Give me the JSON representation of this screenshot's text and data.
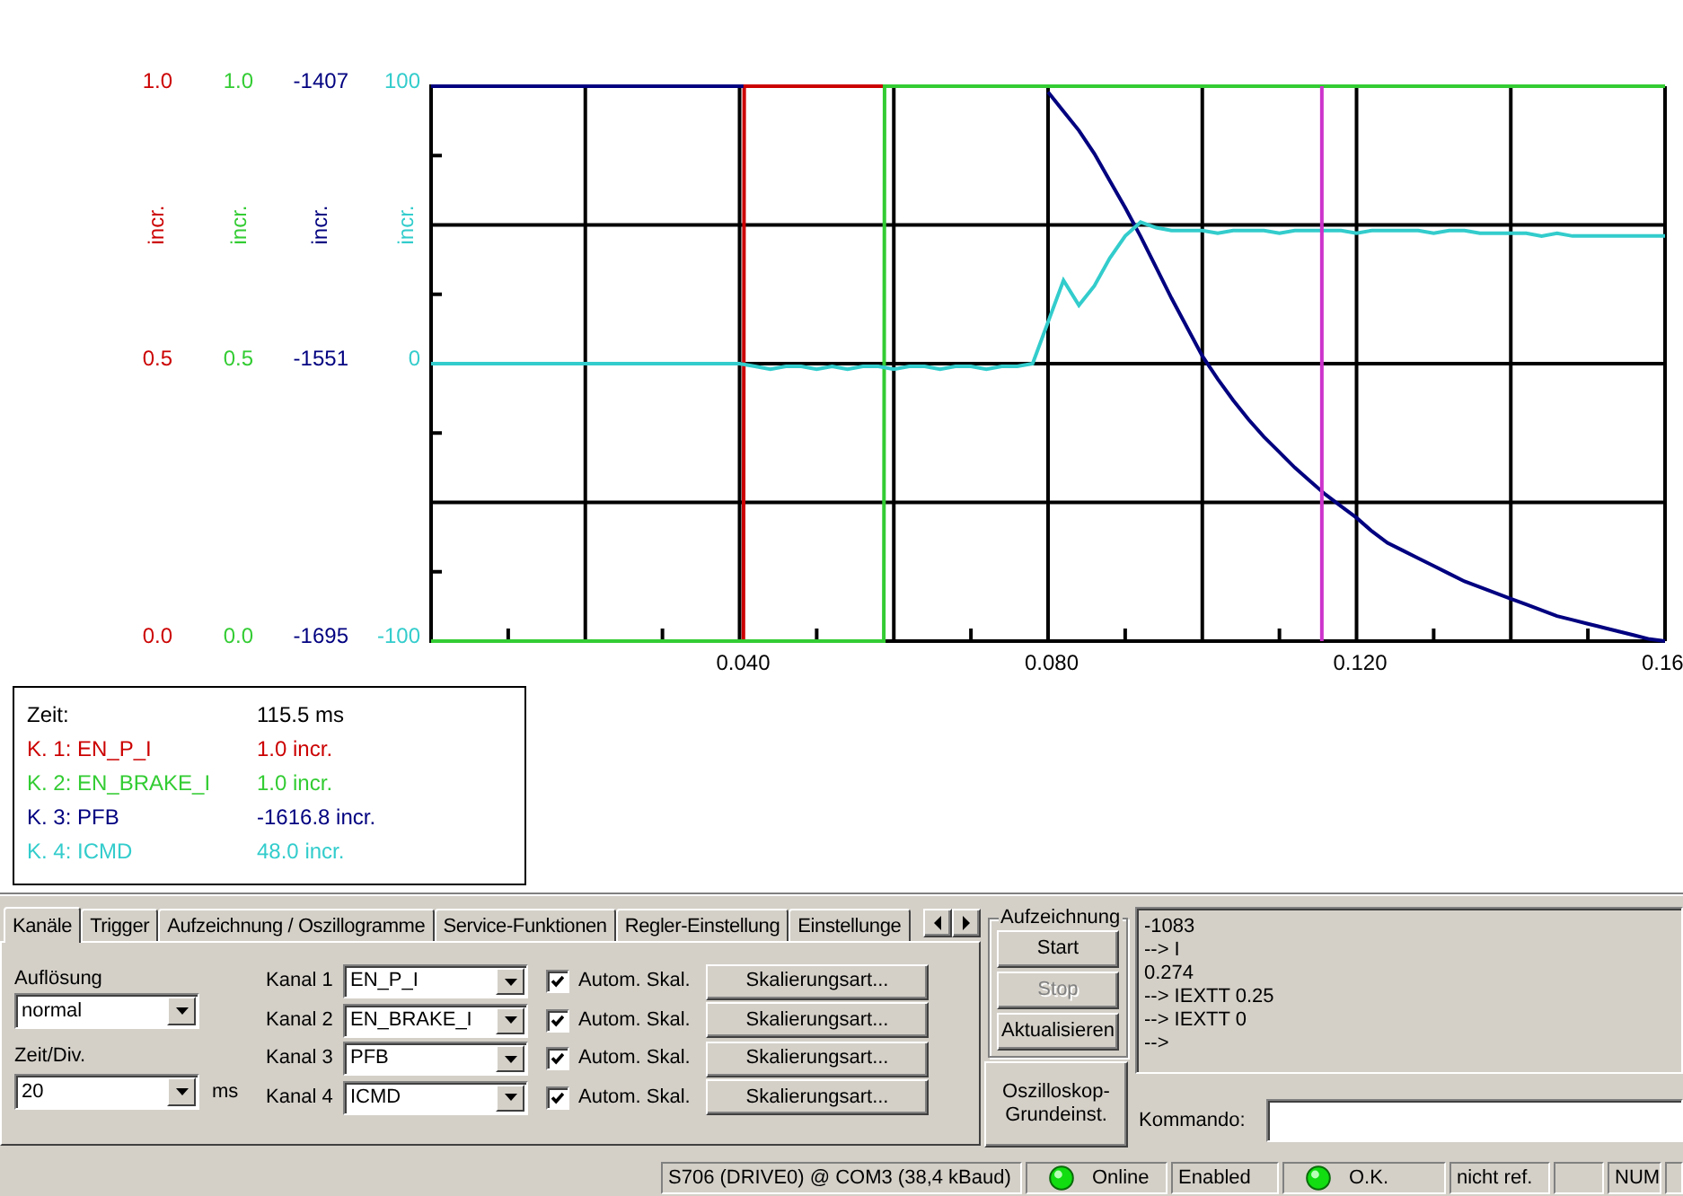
{
  "oscilloscope": {
    "channel_1_scale": {
      "labels": [
        "1.0",
        "0.5",
        "0.0"
      ],
      "unit": "incr."
    },
    "channel_plots": [
      {
        "chart_data": {
          "type": "line",
          "x": [
            0,
            0.0405,
            0.0406,
            0.0587,
            0.0588,
            0.16
          ],
          "xlim": [
            0,
            0.16
          ],
          "ylabel": "incr.",
          "ylim": [
            0,
            1
          ],
          "yticks": [
            {
              "value": 0,
              "label": "0.0"
            },
            {
              "value": 0.5,
              "label": "0.5"
            },
            {
              "value": 1,
              "label": "1.0"
            }
          ],
          "series": [
            {
              "color": "#cc0000",
              "values": [
                null,
                0,
                1,
                1,
                null,
                null
              ]
            },
            {
              "color": "#33cc33",
              "values": [
                0,
                0,
                0,
                0,
                1,
                1
              ]
            }
          ]
        }
      },
      {
        "chart_data": {
          "type": "line",
          "x": [
            0,
            0.0405,
            0.06,
            0.08,
            0.082,
            0.084,
            0.086,
            0.088,
            0.09,
            0.092,
            0.094,
            0.096,
            0.098,
            0.1,
            0.102,
            0.104,
            0.106,
            0.108,
            0.11,
            0.112,
            0.114,
            0.116,
            0.118,
            0.12,
            0.122,
            0.124,
            0.126,
            0.128,
            0.13,
            0.132,
            0.134,
            0.136,
            0.138,
            0.14,
            0.142,
            0.144,
            0.146,
            0.148,
            0.15,
            0.152,
            0.154,
            0.156,
            0.158,
            0.16
          ],
          "xlim": [
            0,
            0.16
          ],
          "ylabel": "incr.",
          "ylim": [
            -1695,
            -1407
          ],
          "yticks": [
            {
              "value": -1695,
              "label": "-1695"
            },
            {
              "value": -1551,
              "label": "-1551"
            },
            {
              "value": -1407,
              "label": "-1407"
            }
          ],
          "series": [
            {
              "color": "#000080",
              "values": [
                -1407,
                -1407,
                null,
                -1410,
                -1420,
                -1430,
                -1442,
                -1456,
                -1470,
                -1485,
                -1501,
                -1517,
                -1532,
                -1547,
                -1559,
                -1570,
                -1580,
                -1589,
                -1597,
                -1605,
                -1612,
                -1619,
                -1625,
                -1631,
                -1638,
                -1644,
                -1648,
                -1652,
                -1656,
                -1660,
                -1664,
                -1667,
                -1670,
                -1673,
                -1676,
                -1679,
                -1682,
                -1684,
                -1686,
                -1688,
                -1690,
                -1692,
                -1694,
                -1695
              ]
            }
          ]
        }
      },
      {
        "chart_data": {
          "type": "line",
          "x": [
            0,
            0.002,
            0.004,
            0.006,
            0.008,
            0.01,
            0.012,
            0.014,
            0.016,
            0.018,
            0.02,
            0.022,
            0.024,
            0.026,
            0.028,
            0.03,
            0.032,
            0.034,
            0.036,
            0.038,
            0.04,
            0.042,
            0.044,
            0.046,
            0.048,
            0.05,
            0.052,
            0.054,
            0.056,
            0.058,
            0.06,
            0.062,
            0.064,
            0.066,
            0.068,
            0.07,
            0.072,
            0.074,
            0.076,
            0.078,
            0.08,
            0.082,
            0.084,
            0.086,
            0.088,
            0.09,
            0.092,
            0.094,
            0.096,
            0.098,
            0.1,
            0.102,
            0.104,
            0.106,
            0.108,
            0.11,
            0.112,
            0.114,
            0.116,
            0.118,
            0.12,
            0.122,
            0.124,
            0.126,
            0.128,
            0.13,
            0.132,
            0.134,
            0.136,
            0.138,
            0.14,
            0.142,
            0.144,
            0.146,
            0.148,
            0.15,
            0.152,
            0.154,
            0.156,
            0.158,
            0.16
          ],
          "xlim": [
            0,
            0.16
          ],
          "xticks": [
            {
              "value": 0.04,
              "label": "0.040"
            },
            {
              "value": 0.08,
              "label": "0.080"
            },
            {
              "value": 0.12,
              "label": "0.120"
            },
            {
              "value": 0.16,
              "label": "0.16"
            }
          ],
          "ylabel": "incr.",
          "ylim": [
            -100,
            100
          ],
          "yticks": [
            {
              "value": -100,
              "label": "-100"
            },
            {
              "value": 0,
              "label": "0"
            },
            {
              "value": 100,
              "label": "100"
            }
          ],
          "series": [
            {
              "color": "#33cccc",
              "values": [
                0,
                0,
                0,
                0,
                0,
                0,
                0,
                0,
                0,
                0,
                0,
                0,
                0,
                0,
                0,
                0,
                0,
                0,
                0,
                0,
                0,
                -1,
                -2,
                -1,
                -1,
                -2,
                -1,
                -2,
                -1,
                -1,
                -2,
                -1,
                -1,
                -2,
                -1,
                -1,
                -2,
                -1,
                -1,
                0,
                15,
                30,
                21,
                28,
                38,
                46,
                51,
                49,
                48,
                48,
                48,
                47,
                48,
                48,
                48,
                47,
                48,
                48,
                48,
                48,
                47,
                48,
                48,
                48,
                48,
                47,
                48,
                48,
                47,
                47,
                47,
                47,
                46,
                47,
                46,
                46,
                46,
                46,
                46,
                46,
                46
              ]
            }
          ],
          "ref_lines": [
            {
              "axis": "x",
              "value": 0.1155,
              "color": "#cc33cc"
            }
          ]
        }
      }
    ]
  },
  "readout": {
    "rows": [
      {
        "label": "Zeit:",
        "value": "115.5 ms",
        "color": "#000000"
      },
      {
        "label": "K. 1: EN_P_I",
        "value": "1.0 incr.",
        "color": "#cc0000"
      },
      {
        "label": "K. 2: EN_BRAKE_I",
        "value": "1.0 incr.",
        "color": "#33cc33"
      },
      {
        "label": "K. 3: PFB",
        "value": "-1616.8 incr.",
        "color": "#000080"
      },
      {
        "label": "K. 4: ICMD",
        "value": "48.0 incr.",
        "color": "#33cccc"
      }
    ]
  },
  "tabs": [
    {
      "label": "Kanäle",
      "selected": true
    },
    {
      "label": "Trigger",
      "selected": false
    },
    {
      "label": "Aufzeichnung / Oszillogramme",
      "selected": false
    },
    {
      "label": "Service-Funktionen",
      "selected": false
    },
    {
      "label": "Regler-Einstellung",
      "selected": false
    },
    {
      "label": "Einstellunge",
      "selected": false
    }
  ],
  "channels_tab": {
    "resolution": {
      "label": "Auflösung",
      "value": "normal"
    },
    "time_per_div": {
      "label": "Zeit/Div.",
      "value": "20",
      "unit": "ms"
    },
    "channels": [
      {
        "label": "Kanal 1",
        "signal": "EN_P_I",
        "auto_scale": {
          "label": "Autom. Skal.",
          "checked": true
        },
        "button": "Skalierungsart..."
      },
      {
        "label": "Kanal 2",
        "signal": "EN_BRAKE_I",
        "auto_scale": {
          "label": "Autom. Skal.",
          "checked": true
        },
        "button": "Skalierungsart..."
      },
      {
        "label": "Kanal 3",
        "signal": "PFB",
        "auto_scale": {
          "label": "Autom. Skal.",
          "checked": true
        },
        "button": "Skalierungsart..."
      },
      {
        "label": "Kanal 4",
        "signal": "ICMD",
        "auto_scale": {
          "label": "Autom. Skal.",
          "checked": true
        },
        "button": "Skalierungsart..."
      }
    ]
  },
  "recording": {
    "title": "Aufzeichnung",
    "buttons": [
      {
        "label": "Start",
        "disabled": false
      },
      {
        "label": "Stop",
        "disabled": true
      },
      {
        "label": "Aktualisieren",
        "disabled": false
      }
    ]
  },
  "scope_defaults_button": {
    "label": "Oszilloskop-Grundeinst."
  },
  "console": {
    "lines": [
      "-1083",
      "--> I",
      "0.274",
      "--> IEXTT 0.25",
      "--> IEXTT 0",
      "-->"
    ]
  },
  "command": {
    "label": "Kommando:"
  },
  "status_bar": {
    "panels": [
      {
        "kind": "text",
        "text": "S706 (DRIVE0) @ COM3 (38,4 kBaud)"
      },
      {
        "kind": "led",
        "on": true,
        "text": "Online"
      },
      {
        "kind": "text",
        "text": "Enabled"
      },
      {
        "kind": "led",
        "on": true,
        "text": "O.K."
      },
      {
        "kind": "text",
        "text": "nicht ref."
      },
      {
        "kind": "blank"
      },
      {
        "kind": "text",
        "text": "NUM"
      },
      {
        "kind": "blank"
      }
    ]
  }
}
